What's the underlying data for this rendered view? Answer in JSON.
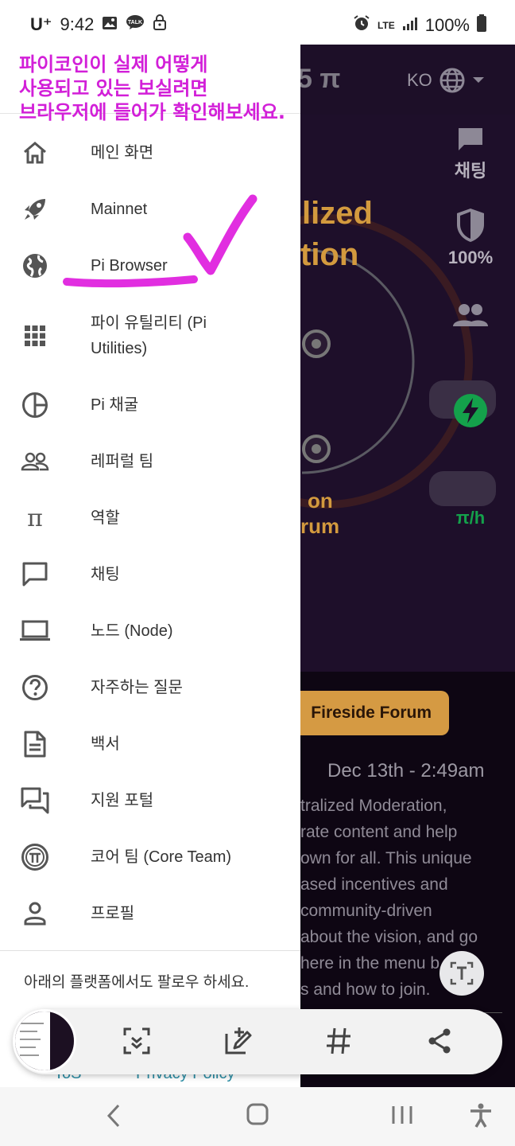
{
  "status_bar": {
    "carrier": "U⁺",
    "time": "9:42",
    "icons_left": [
      "image-icon",
      "talk-icon",
      "lock-icon"
    ],
    "talk_badge": "TALK",
    "network": "LTE",
    "battery": "100%"
  },
  "annotation": {
    "line1": "파이코인이 실제 어떻게",
    "line2": "사용되고 있는 보실려면",
    "line3": "브라우저에 들어가 확인해보세요.",
    "color": "#d21fd8"
  },
  "background_app": {
    "lang_code": "KO",
    "hero_line1": "lized",
    "hero_line2": "tion",
    "hero_sub1": "on",
    "hero_sub2": "rum",
    "side_chat": "채팅",
    "side_security": "100%",
    "side_rate": "π/h",
    "forum_button": "Fireside Forum",
    "date": "Dec 13th - 2:49am",
    "article_lines": [
      "tralized Moderation,",
      "rate content and help",
      " own for all. This unique",
      "ased incentives and",
      "community-driven",
      "about the vision, and go",
      "here in the menu b",
      "s and how to join."
    ]
  },
  "menu": {
    "items": [
      {
        "icon": "home-icon",
        "label": "메인 화면"
      },
      {
        "icon": "rocket-icon",
        "label": "Mainnet"
      },
      {
        "icon": "globe-icon",
        "label": "Pi Browser"
      },
      {
        "icon": "grid-icon",
        "label": "파이 유틸리티 (Pi",
        "label2": "Utilities)"
      },
      {
        "icon": "pie-chart-icon",
        "label": "Pi 채굴"
      },
      {
        "icon": "team-icon",
        "label": "레퍼럴 팀"
      },
      {
        "icon": "pi-icon",
        "label": "역할"
      },
      {
        "icon": "chat-icon",
        "label": "채팅"
      },
      {
        "icon": "laptop-icon",
        "label": "노드 (Node)"
      },
      {
        "icon": "help-icon",
        "label": "자주하는 질문"
      },
      {
        "icon": "document-icon",
        "label": "백서"
      },
      {
        "icon": "forum-icon",
        "label": "지원 포털"
      },
      {
        "icon": "pi-coin-icon",
        "label": "코어 팀 (Core Team)"
      },
      {
        "icon": "person-icon",
        "label": "프로필"
      }
    ],
    "follow_text": "아래의 플랫폼에서도 팔로우 하세요.",
    "tos": "ToS",
    "privacy": "Privacy Policy"
  },
  "toolbar": {
    "icons": [
      "scan-icon",
      "edit-icon",
      "hashtag-icon",
      "share-icon"
    ]
  },
  "navbar": {
    "icons": [
      "back-icon",
      "home-button-icon",
      "recents-icon",
      "accessibility-icon"
    ]
  }
}
